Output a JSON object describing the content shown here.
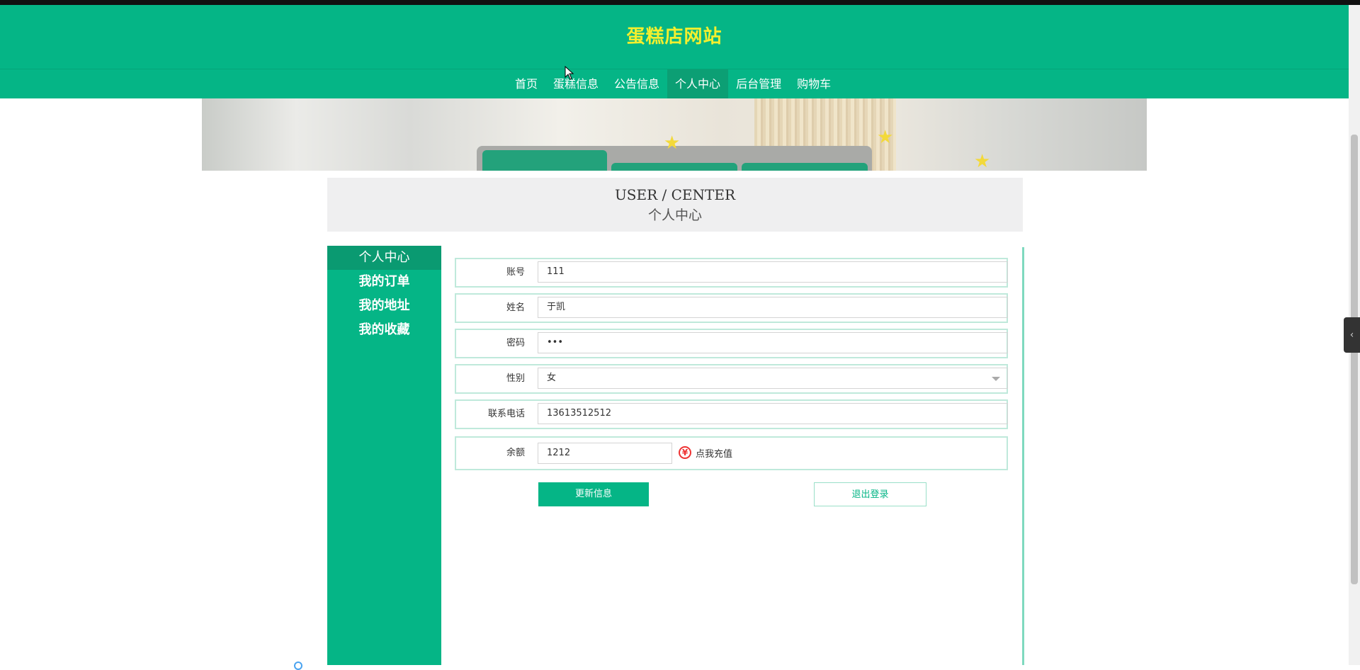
{
  "site": {
    "title": "蛋糕店网站"
  },
  "nav": {
    "items": [
      {
        "label": "首页"
      },
      {
        "label": "蛋糕信息"
      },
      {
        "label": "公告信息"
      },
      {
        "label": "个人中心"
      },
      {
        "label": "后台管理"
      },
      {
        "label": "购物车"
      }
    ],
    "active": "个人中心"
  },
  "center_heading": {
    "en": "USER / CENTER",
    "cn": "个人中心"
  },
  "sidebar": {
    "items": [
      {
        "label": "个人中心"
      },
      {
        "label": "我的订单"
      },
      {
        "label": "我的地址"
      },
      {
        "label": "我的收藏"
      }
    ],
    "active": "个人中心"
  },
  "form": {
    "account": {
      "label": "账号",
      "value": "111"
    },
    "name": {
      "label": "姓名",
      "value": "于凯"
    },
    "password": {
      "label": "密码",
      "value": "•••"
    },
    "gender": {
      "label": "性别",
      "value": "女"
    },
    "phone": {
      "label": "联系电话",
      "value": "13613512512"
    },
    "balance": {
      "label": "余额",
      "value": "1212",
      "recharge_label": "点我充值",
      "icon": "yen-icon"
    }
  },
  "buttons": {
    "update": "更新信息",
    "logout": "退出登录"
  },
  "colors": {
    "primary": "#05b586",
    "title": "#f4ef2e",
    "active_nav": "#0c9f74"
  }
}
